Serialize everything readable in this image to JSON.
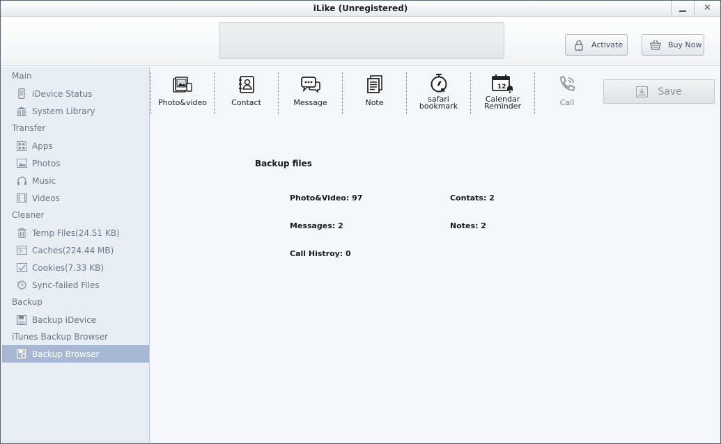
{
  "window": {
    "title": "iLike (Unregistered)"
  },
  "header": {
    "activate_label": "Activate",
    "buy_label": "Buy Now"
  },
  "sidebar": {
    "sections": [
      {
        "label": "Main",
        "items": [
          {
            "label": "iDevice Status",
            "icon": "phone-icon"
          },
          {
            "label": "System Library",
            "icon": "library-icon"
          }
        ]
      },
      {
        "label": "Transfer",
        "items": [
          {
            "label": "Apps",
            "icon": "apps-icon"
          },
          {
            "label": "Photos",
            "icon": "photo-icon"
          },
          {
            "label": "Music",
            "icon": "headphones-icon"
          },
          {
            "label": "Videos",
            "icon": "film-icon"
          }
        ]
      },
      {
        "label": "Cleaner",
        "items": [
          {
            "label": "Temp Files(24.51 KB)",
            "icon": "trash-icon"
          },
          {
            "label": "Caches(224.44 MB)",
            "icon": "cache-icon"
          },
          {
            "label": "Cookies(7.33 KB)",
            "icon": "cookie-icon"
          },
          {
            "label": "Sync-failed Files",
            "icon": "sync-failed-icon"
          }
        ]
      },
      {
        "label": "Backup",
        "items": [
          {
            "label": "Backup iDevice",
            "icon": "backup-icon"
          }
        ]
      },
      {
        "label": "iTunes Backup Browser",
        "items": [
          {
            "label": "Backup Browser",
            "icon": "backup-browser-icon",
            "active": true
          }
        ]
      }
    ]
  },
  "toolbar": {
    "tools": [
      {
        "label": "Photo&video",
        "icon": "photo-video-icon"
      },
      {
        "label": "Contact",
        "icon": "contact-icon"
      },
      {
        "label": "Message",
        "icon": "message-icon"
      },
      {
        "label": "Note",
        "icon": "note-icon"
      },
      {
        "label": "safari\nbookmark",
        "icon": "safari-bookmark-icon"
      },
      {
        "label": "Calendar\nReminder",
        "icon": "calendar-icon",
        "calendar_day": "12"
      },
      {
        "label": "Call",
        "icon": "call-icon",
        "disabled": true
      }
    ],
    "save_label": "Save"
  },
  "main": {
    "backup_title": "Backup files",
    "stats": {
      "photo_video": "Photo&Video: 97",
      "contacts": "Contats: 2",
      "messages": "Messages: 2",
      "notes": "Notes: 2",
      "call_history": "Call Histroy: 0"
    }
  },
  "colors": {
    "active_item_bg": "#a6b8d4",
    "sidebar_bg": "#e9eef4",
    "main_bg": "#f4f6f9"
  }
}
